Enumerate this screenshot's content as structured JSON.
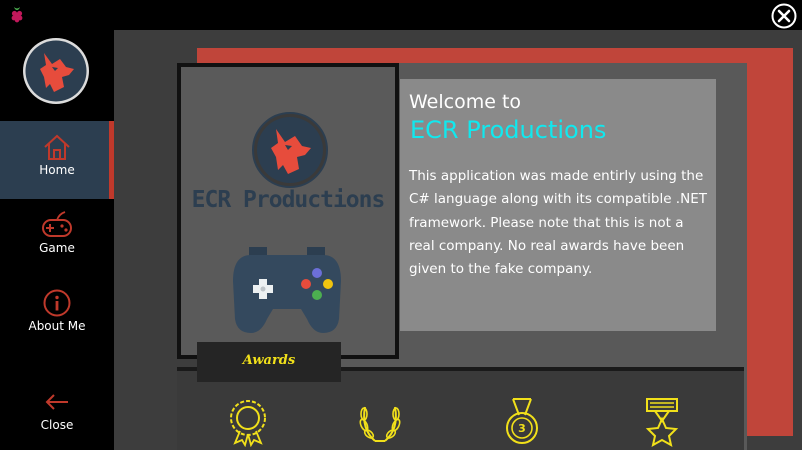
{
  "titlebar": {
    "app_icon": "raspberry-icon",
    "close_icon": "close-icon"
  },
  "colors": {
    "accent_red": "#c0392b",
    "nav_active_bg": "#2c3e50",
    "brand_cyan": "#11e8ee",
    "award_yellow": "#f1e01a"
  },
  "sidebar": {
    "logo_icon": "wolf-logo-icon",
    "items": [
      {
        "label": "Home",
        "icon": "home-icon"
      },
      {
        "label": "Game",
        "icon": "gamepad-icon"
      },
      {
        "label": "About Me",
        "icon": "info-icon"
      },
      {
        "label": "Close",
        "icon": "arrow-left-icon"
      }
    ]
  },
  "main": {
    "card": {
      "logo_text": "ECR Productions",
      "tab_label": "Awards"
    },
    "welcome": {
      "line1": "Welcome to",
      "brand": "ECR Productions",
      "body": "This application was made entirly using the C# language along with its compatible .NET framework. Please note that this is not a real company. No real awards have been given to the fake company."
    },
    "awards": {
      "icons": [
        "rosette-icon",
        "laurel-wreath-icon",
        "medal-3-icon",
        "star-medal-icon"
      ],
      "medal_number": "3"
    }
  }
}
